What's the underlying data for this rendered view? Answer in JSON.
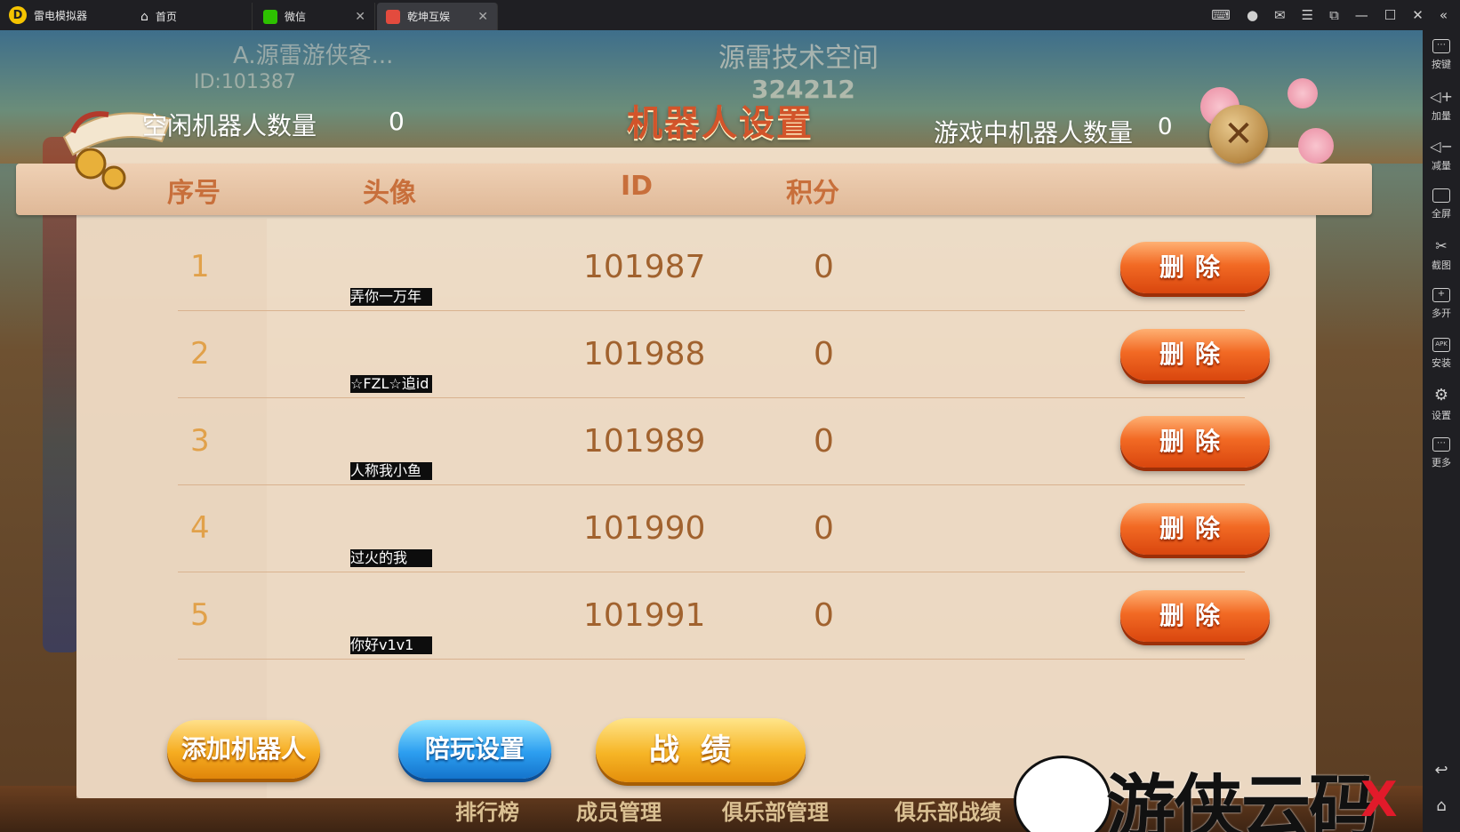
{
  "titlebar": {
    "app_name": "雷电模拟器",
    "tabs": [
      {
        "label": "首页",
        "icon": "home-icon"
      },
      {
        "label": "微信",
        "icon": "wechat-icon"
      },
      {
        "label": "乾坤互娱",
        "icon": "game-icon",
        "active": true
      }
    ]
  },
  "sidebar": {
    "items": [
      {
        "label": "按键",
        "icon": "keyboard-icon"
      },
      {
        "label": "加量",
        "icon": "volume-up-icon"
      },
      {
        "label": "减量",
        "icon": "volume-down-icon"
      },
      {
        "label": "全屏",
        "icon": "fullscreen-icon"
      },
      {
        "label": "截图",
        "icon": "scissors-icon"
      },
      {
        "label": "多开",
        "icon": "multi-instance-icon"
      },
      {
        "label": "安装",
        "icon": "apk-icon"
      },
      {
        "label": "设置",
        "icon": "gear-icon"
      },
      {
        "label": "更多",
        "icon": "more-icon"
      }
    ]
  },
  "background": {
    "player_name": "A.源雷游侠客...",
    "player_id": "ID:101387",
    "room_name": "源雷技术空间",
    "room_number": "324212",
    "bottom_nav": [
      "排行榜",
      "成员管理",
      "俱乐部管理",
      "俱乐部战绩"
    ]
  },
  "dialog": {
    "title": "机器人设置",
    "idle_label": "空闲机器人数量",
    "idle_count": "0",
    "ingame_label": "游戏中机器人数量",
    "ingame_count": "0",
    "close_symbol": "✕",
    "columns": {
      "index": "序号",
      "avatar": "头像",
      "id": "ID",
      "score": "积分"
    },
    "rows": [
      {
        "index": "1",
        "name": "弄你一万年",
        "id": "101987",
        "score": "0",
        "delete_label": "删除"
      },
      {
        "index": "2",
        "name": "☆FZL☆追id",
        "id": "101988",
        "score": "0",
        "delete_label": "删除"
      },
      {
        "index": "3",
        "name": "人称我小鱼",
        "id": "101989",
        "score": "0",
        "delete_label": "删除"
      },
      {
        "index": "4",
        "name": "过火的我",
        "id": "101990",
        "score": "0",
        "delete_label": "删除"
      },
      {
        "index": "5",
        "name": "你好v1v1",
        "id": "101991",
        "score": "0",
        "delete_label": "删除"
      }
    ],
    "buttons": {
      "add_robot": "添加机器人",
      "companion_settings": "陪玩设置",
      "record": "战绩"
    }
  },
  "watermark": {
    "text": "游侠云码",
    "x_mark": "X"
  },
  "colors": {
    "title_orange": "#d2542a",
    "delete_button": "#f26a24",
    "add_button": "#f6ad21",
    "play_button": "#2d9ff0",
    "record_button": "#f6b526"
  }
}
